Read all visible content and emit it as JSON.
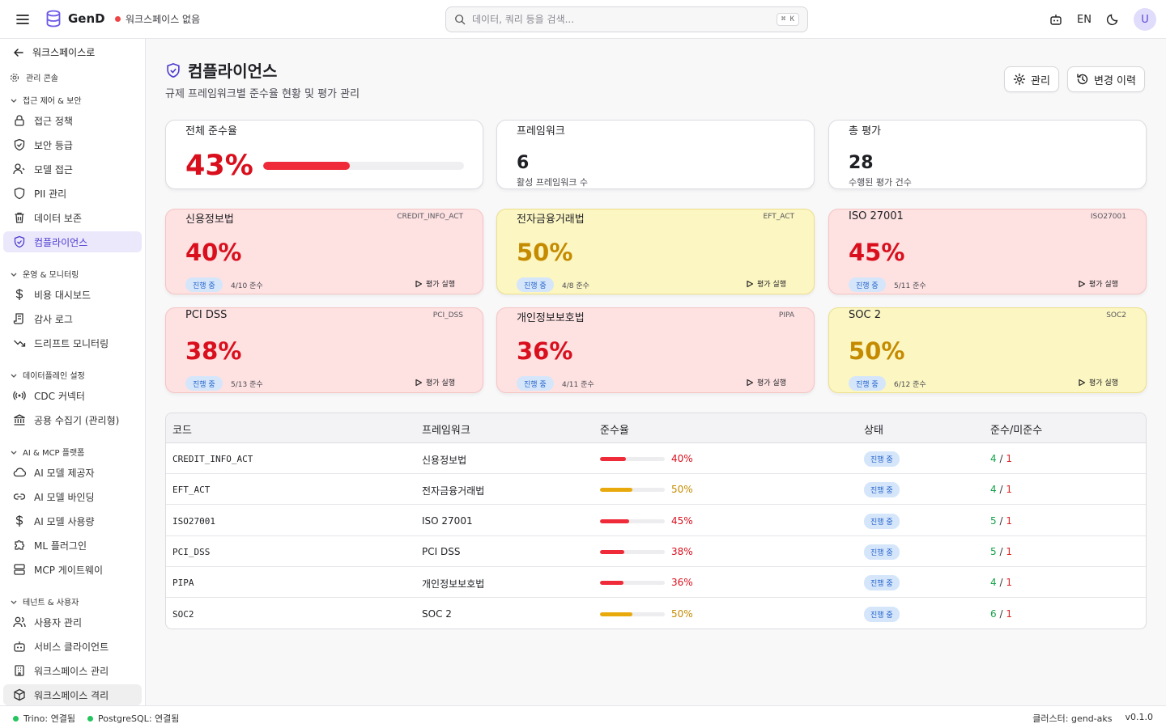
{
  "app": {
    "name": "GenD",
    "workspace_status": "워크스페이스 없음"
  },
  "search": {
    "placeholder": "데이터, 쿼리 등을 검색...",
    "shortcut": "⌘ K"
  },
  "topbar": {
    "lang": "EN",
    "avatar": "U"
  },
  "sidebar": {
    "back": "워크스페이스로",
    "console": "관리 콘솔",
    "sections": [
      {
        "title": "접근 제어 & 보안",
        "items": [
          "접근 정책",
          "보안 등급",
          "모델 접근",
          "PII 관리",
          "데이터 보존",
          "컴플라이언스"
        ]
      },
      {
        "title": "운영 & 모니터링",
        "items": [
          "비용 대시보드",
          "감사 로그",
          "드리프트 모니터링"
        ]
      },
      {
        "title": "데이터플레인 설정",
        "items": [
          "CDC 커넥터",
          "공용 수집기 (관리형)"
        ]
      },
      {
        "title": "AI & MCP 플랫폼",
        "items": [
          "AI 모델 제공자",
          "AI 모델 바인딩",
          "AI 모델 사용량",
          "ML 플러그인",
          "MCP 게이트웨이"
        ]
      },
      {
        "title": "테넌트 & 사용자",
        "items": [
          "사용자 관리",
          "서비스 클라이언트",
          "워크스페이스 관리",
          "워크스페이스 격리"
        ]
      }
    ]
  },
  "page": {
    "title": "컴플라이언스",
    "subtitle": "규제 프레임워크별 준수율 현황 및 평가 관리",
    "manage_button": "관리",
    "history_button": "변경 이력"
  },
  "stats": {
    "overall": {
      "label": "전체 준수율",
      "value": "43%",
      "percent": 43
    },
    "frameworks": {
      "label": "프레임워크",
      "value": "6",
      "caption": "활성 프레임워크 수"
    },
    "assessments": {
      "label": "총 평가",
      "value": "28",
      "caption": "수행된 평가 건수"
    }
  },
  "framework_cards": [
    {
      "name": "신용정보법",
      "code": "CREDIT_INFO_ACT",
      "pct": "40%",
      "status": "진행 중",
      "pass": "4/10 준수",
      "run": "평가 실행",
      "level": "red"
    },
    {
      "name": "전자금융거래법",
      "code": "EFT_ACT",
      "pct": "50%",
      "status": "진행 중",
      "pass": "4/8 준수",
      "run": "평가 실행",
      "level": "yellow"
    },
    {
      "name": "ISO 27001",
      "code": "ISO27001",
      "pct": "45%",
      "status": "진행 중",
      "pass": "5/11 준수",
      "run": "평가 실행",
      "level": "red"
    },
    {
      "name": "PCI DSS",
      "code": "PCI_DSS",
      "pct": "38%",
      "status": "진행 중",
      "pass": "5/13 준수",
      "run": "평가 실행",
      "level": "red"
    },
    {
      "name": "개인정보보호법",
      "code": "PIPA",
      "pct": "36%",
      "status": "진행 중",
      "pass": "4/11 준수",
      "run": "평가 실행",
      "level": "red"
    },
    {
      "name": "SOC 2",
      "code": "SOC2",
      "pct": "50%",
      "status": "진행 중",
      "pass": "6/12 준수",
      "run": "평가 실행",
      "level": "yellow"
    }
  ],
  "table": {
    "headers": [
      "코드",
      "프레임워크",
      "준수율",
      "상태",
      "준수/미준수"
    ],
    "rows": [
      {
        "code": "CREDIT_INFO_ACT",
        "name": "신용정보법",
        "rate": "40%",
        "rate_value": 40,
        "status": "진행 중",
        "pass": "4",
        "sep": "/",
        "fail": "1",
        "color": "#ef2b3a"
      },
      {
        "code": "EFT_ACT",
        "name": "전자금융거래법",
        "rate": "50%",
        "rate_value": 50,
        "status": "진행 중",
        "pass": "4",
        "sep": "/",
        "fail": "1",
        "color": "#e8a90c"
      },
      {
        "code": "ISO27001",
        "name": "ISO 27001",
        "rate": "45%",
        "rate_value": 45,
        "status": "진행 중",
        "pass": "5",
        "sep": "/",
        "fail": "1",
        "color": "#ef2b3a"
      },
      {
        "code": "PCI_DSS",
        "name": "PCI DSS",
        "rate": "38%",
        "rate_value": 38,
        "status": "진행 중",
        "pass": "5",
        "sep": "/",
        "fail": "1",
        "color": "#ef2b3a"
      },
      {
        "code": "PIPA",
        "name": "개인정보보호법",
        "rate": "36%",
        "rate_value": 36,
        "status": "진행 중",
        "pass": "4",
        "sep": "/",
        "fail": "1",
        "color": "#ef2b3a"
      },
      {
        "code": "SOC2",
        "name": "SOC 2",
        "rate": "50%",
        "rate_value": 50,
        "status": "진행 중",
        "pass": "6",
        "sep": "/",
        "fail": "1",
        "color": "#e8a90c"
      }
    ]
  },
  "statusbar": {
    "trino": "Trino: 연결됨",
    "postgres": "PostgreSQL: 연결됨",
    "cluster": "클러스터: gend-aks",
    "version": "v0.1.0"
  },
  "colors": {
    "accent": "#4c3ccf",
    "danger": "#d90f1d",
    "warning": "#c58b00",
    "success": "#16a34a"
  }
}
